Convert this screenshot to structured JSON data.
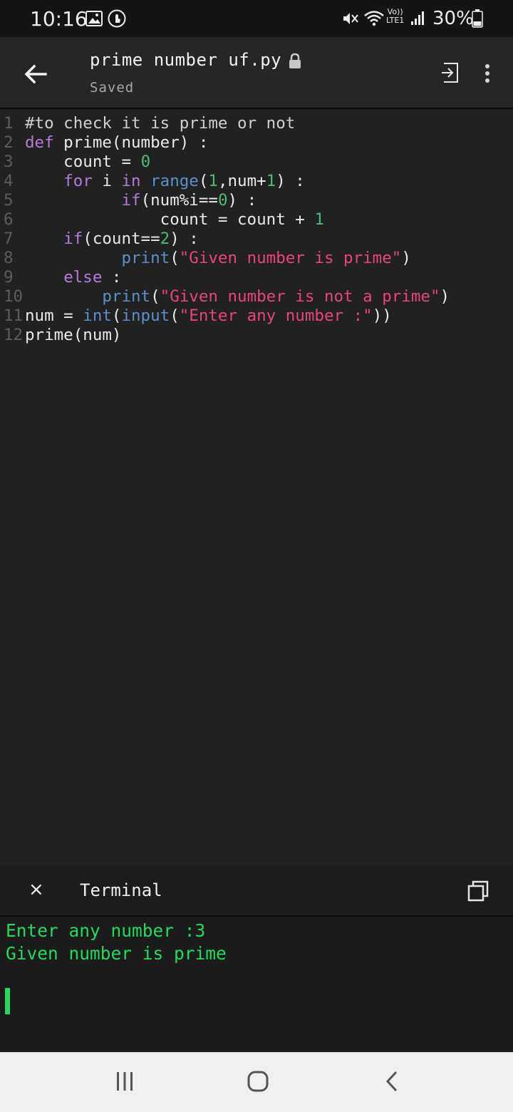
{
  "status_bar": {
    "time": "10:16",
    "battery": "30%",
    "network": "LTE1",
    "icons": [
      "gallery-icon",
      "touch-icon",
      "mute-icon",
      "wifi-icon",
      "volte-icon",
      "signal-icon",
      "battery-icon"
    ]
  },
  "header": {
    "title": "prime number uf.py",
    "subtitle": "Saved",
    "icons": [
      "back-arrow-icon",
      "lock-icon",
      "run-icon",
      "more-vert-icon"
    ]
  },
  "editor": {
    "lines": [
      {
        "n": "1",
        "tokens": [
          {
            "t": "#to check it is prime or not",
            "c": "cm"
          }
        ]
      },
      {
        "n": "2",
        "tokens": [
          {
            "t": "def",
            "c": "kw"
          },
          {
            "t": " prime(number) :",
            "c": "t-text"
          }
        ]
      },
      {
        "n": "3",
        "tokens": [
          {
            "t": "    count = ",
            "c": "t-text"
          },
          {
            "t": "0",
            "c": "num"
          }
        ]
      },
      {
        "n": "4",
        "tokens": [
          {
            "t": "    ",
            "c": "t-text"
          },
          {
            "t": "for",
            "c": "kw"
          },
          {
            "t": " i ",
            "c": "t-text"
          },
          {
            "t": "in",
            "c": "kw"
          },
          {
            "t": " ",
            "c": "t-text"
          },
          {
            "t": "range",
            "c": "bi"
          },
          {
            "t": "(",
            "c": "t-text"
          },
          {
            "t": "1",
            "c": "num"
          },
          {
            "t": ",num+",
            "c": "t-text"
          },
          {
            "t": "1",
            "c": "num"
          },
          {
            "t": ") :",
            "c": "t-text"
          }
        ]
      },
      {
        "n": "5",
        "tokens": [
          {
            "t": "          ",
            "c": "t-text"
          },
          {
            "t": "if",
            "c": "kw"
          },
          {
            "t": "(num%i==",
            "c": "t-text"
          },
          {
            "t": "0",
            "c": "num"
          },
          {
            "t": ") :",
            "c": "t-text"
          }
        ]
      },
      {
        "n": "6",
        "tokens": [
          {
            "t": "              count = count + ",
            "c": "t-text"
          },
          {
            "t": "1",
            "c": "num"
          }
        ]
      },
      {
        "n": "7",
        "tokens": [
          {
            "t": "    ",
            "c": "t-text"
          },
          {
            "t": "if",
            "c": "kw"
          },
          {
            "t": "(count==",
            "c": "t-text"
          },
          {
            "t": "2",
            "c": "num"
          },
          {
            "t": ") :",
            "c": "t-text"
          }
        ]
      },
      {
        "n": "8",
        "tokens": [
          {
            "t": "          ",
            "c": "t-text"
          },
          {
            "t": "print",
            "c": "bi"
          },
          {
            "t": "(",
            "c": "t-text"
          },
          {
            "t": "\"Given number is prime\"",
            "c": "str"
          },
          {
            "t": ")",
            "c": "t-text"
          }
        ]
      },
      {
        "n": "9",
        "tokens": [
          {
            "t": "    ",
            "c": "t-text"
          },
          {
            "t": "else",
            "c": "kw"
          },
          {
            "t": " :",
            "c": "t-text"
          }
        ]
      },
      {
        "n": "10",
        "tokens": [
          {
            "t": "        ",
            "c": "t-text"
          },
          {
            "t": "print",
            "c": "bi"
          },
          {
            "t": "(",
            "c": "t-text"
          },
          {
            "t": "\"Given number is not a prime\"",
            "c": "str"
          },
          {
            "t": ")",
            "c": "t-text"
          }
        ]
      },
      {
        "n": "11",
        "tokens": [
          {
            "t": "num = ",
            "c": "t-text"
          },
          {
            "t": "int",
            "c": "bi"
          },
          {
            "t": "(",
            "c": "t-text"
          },
          {
            "t": "input",
            "c": "bi"
          },
          {
            "t": "(",
            "c": "t-text"
          },
          {
            "t": "\"Enter any number :\"",
            "c": "str"
          },
          {
            "t": "))",
            "c": "t-text"
          }
        ]
      },
      {
        "n": "12",
        "tokens": [
          {
            "t": "prime(num)",
            "c": "t-text"
          }
        ]
      }
    ]
  },
  "terminal": {
    "close_label": "×",
    "title": "Terminal",
    "output": [
      "Enter any number :3",
      "Given number is prime"
    ]
  },
  "nav": {
    "icons": [
      "recent-apps-icon",
      "home-icon",
      "back-icon"
    ]
  },
  "colors": {
    "keyword": "#b47bd6",
    "builtin": "#5f8fc9",
    "number": "#4fb873",
    "string": "#e8457a",
    "terminal_text": "#24d95f"
  }
}
